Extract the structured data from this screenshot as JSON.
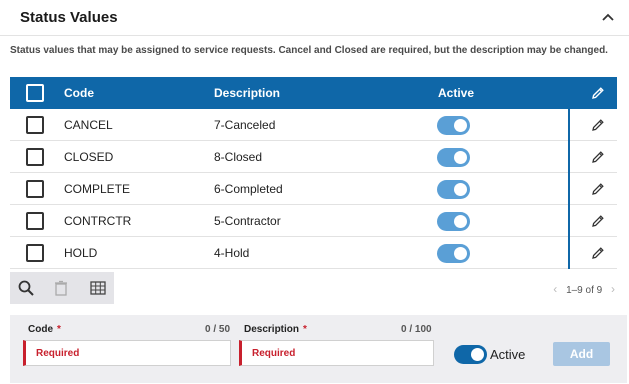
{
  "header": {
    "title": "Status Values"
  },
  "description": "Status values that may be assigned to service requests. Cancel and Closed are required, but the description may be changed.",
  "table": {
    "headers": {
      "code": "Code",
      "description": "Description",
      "active": "Active"
    },
    "rows": [
      {
        "code": "CANCEL",
        "description": "7-Canceled",
        "active": true
      },
      {
        "code": "CLOSED",
        "description": "8-Closed",
        "active": true
      },
      {
        "code": "COMPLETE",
        "description": "6-Completed",
        "active": true
      },
      {
        "code": "CONTRCTR",
        "description": "5-Contractor",
        "active": true
      },
      {
        "code": "HOLD",
        "description": "4-Hold",
        "active": true
      }
    ]
  },
  "pager": {
    "label": "1–9 of 9",
    "prev": "‹",
    "next": "›"
  },
  "form": {
    "code": {
      "label": "Code",
      "required_marker": "*",
      "count": "0 / 50",
      "placeholder": "Required"
    },
    "description": {
      "label": "Description",
      "required_marker": "*",
      "count": "0 / 100",
      "placeholder": "Required"
    },
    "active_label": "Active",
    "add_label": "Add"
  },
  "colors": {
    "header_blue": "#0f67a8",
    "toggle_on": "#5a9fd6",
    "required_red": "#c8202d"
  }
}
